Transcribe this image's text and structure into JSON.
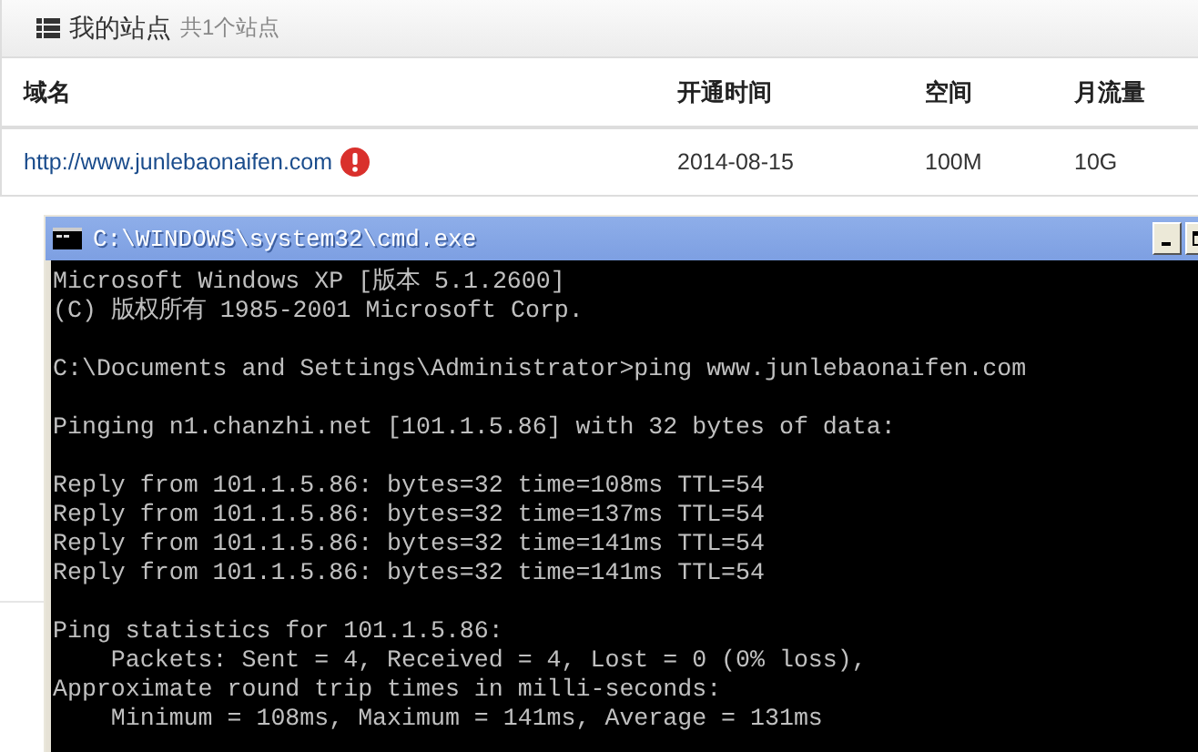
{
  "panel": {
    "title": "我的站点",
    "count": "共1个站点"
  },
  "table": {
    "columns": [
      "域名",
      "开通时间",
      "空间",
      "月流量"
    ],
    "rows": [
      {
        "domain": "http://www.junlebaonaifen.com",
        "warning": true,
        "opened": "2014-08-15",
        "space": "100M",
        "traffic": "10G"
      }
    ]
  },
  "console": {
    "title": "C:\\WINDOWS\\system32\\cmd.exe",
    "blocks": [
      [
        "Microsoft Windows XP [版本 5.1.2600]",
        "(C) 版权所有 1985-2001 Microsoft Corp."
      ],
      [
        "C:\\Documents and Settings\\Administrator>ping www.junlebaonaifen.com"
      ],
      [
        "Pinging n1.chanzhi.net [101.1.5.86] with 32 bytes of data:"
      ],
      [
        "Reply from 101.1.5.86: bytes=32 time=108ms TTL=54",
        "Reply from 101.1.5.86: bytes=32 time=137ms TTL=54",
        "Reply from 101.1.5.86: bytes=32 time=141ms TTL=54",
        "Reply from 101.1.5.86: bytes=32 time=141ms TTL=54"
      ],
      [
        "Ping statistics for 101.1.5.86:",
        "    Packets: Sent = 4, Received = 4, Lost = 0 (0% loss),",
        "Approximate round trip times in milli-seconds:",
        "    Minimum = 108ms, Maximum = 141ms, Average = 131ms"
      ]
    ]
  }
}
